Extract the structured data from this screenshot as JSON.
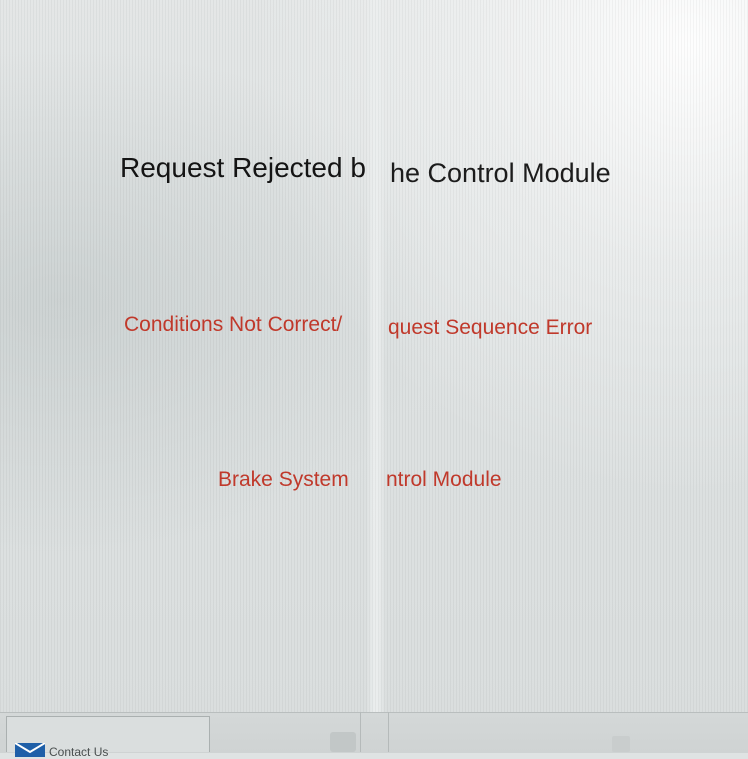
{
  "dialog": {
    "title_left": "Request Rejected b",
    "title_right": "he Control Module",
    "condition_left": "Conditions Not Correct/",
    "condition_right": "quest Sequence Error",
    "module_left": "Brake System",
    "module_right": "ntrol Module"
  },
  "footer": {
    "contact_label": "Contact Us"
  },
  "icons": {
    "contact": "mail-icon"
  },
  "colors": {
    "error_text": "#c0392b",
    "title_text": "#141414",
    "mail_icon": "#1f5fa8"
  }
}
